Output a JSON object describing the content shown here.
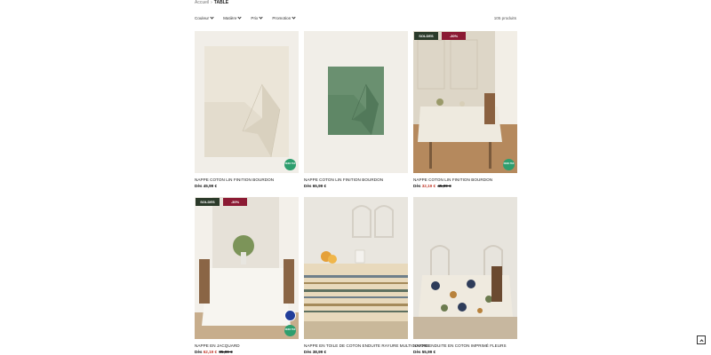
{
  "breadcrumb": {
    "home": "Accueil",
    "separator": "›",
    "current": "TABLE"
  },
  "filters": [
    {
      "label": "Couleur"
    },
    {
      "label": "Matière"
    },
    {
      "label": "Prix"
    },
    {
      "label": "Promotion"
    }
  ],
  "product_count": "105 produits",
  "products": [
    {
      "name": "NAPPE COTON LIN FINITION BOURDON",
      "price_prefix": "Dès",
      "price": "45,99 €",
      "sale_price": "",
      "old_price": "",
      "badge_soldes": "",
      "badge_discount": "",
      "eco_label": "OEKO TEX",
      "image": "cream-tablecloth-folded"
    },
    {
      "name": "NAPPE COTON LIN FINITION BOURDON",
      "price_prefix": "Dès",
      "price": "65,99 €",
      "sale_price": "",
      "old_price": "",
      "badge_soldes": "",
      "badge_discount": "",
      "eco_label": "",
      "image": "green-tablecloth-folded"
    },
    {
      "name": "NAPPE COTON LIN FINITION BOURDON",
      "price_prefix": "Dès",
      "price": "",
      "sale_price": "32,19 €",
      "old_price": "45,99 €",
      "badge_soldes": "SOLDES",
      "badge_discount": "-30%",
      "eco_label": "OEKO TEX",
      "image": "dining-room-cream-table"
    },
    {
      "name": "NAPPE EN JACQUARD",
      "price_prefix": "Dès",
      "price": "",
      "sale_price": "62,19 €",
      "old_price": "85,99 €",
      "badge_soldes": "SOLDES",
      "badge_discount": "-30%",
      "eco_label": "OEKO TEX",
      "image": "dining-room-white-table"
    },
    {
      "name": "NAPPE EN TOILE DE COTON ENDUITE RAYURE MULTICOLORE",
      "price_prefix": "Dès",
      "price": "38,99 €",
      "sale_price": "",
      "old_price": "",
      "badge_soldes": "",
      "badge_discount": "",
      "eco_label": "",
      "image": "striped-tablecloth-room"
    },
    {
      "name": "NAPPE ENDUITE EN COTON IMPRIMÉ FLEURS",
      "price_prefix": "Dès",
      "price": "55,99 €",
      "sale_price": "",
      "old_price": "",
      "badge_soldes": "",
      "badge_discount": "",
      "eco_label": "",
      "image": "floral-tablecloth-room"
    }
  ],
  "colors": {
    "soldes_bg": "#2b3a2a",
    "discount_bg": "#8b1a33",
    "sale_price": "#c0392b",
    "eco_badge": "#2e9e6e"
  },
  "icons": {
    "scroll_top": "chevron-up-icon"
  }
}
